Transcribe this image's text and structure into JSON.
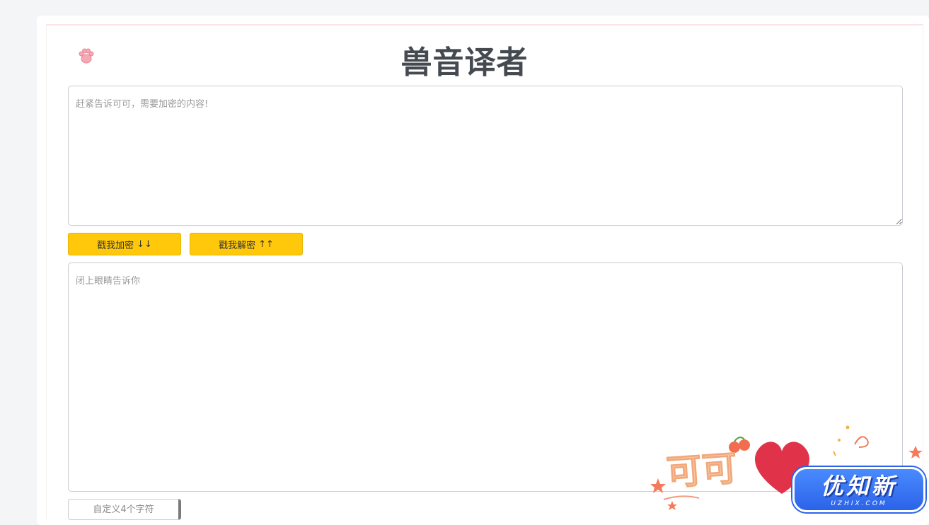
{
  "header": {
    "title": "兽音译者",
    "logo_icon": "paw-icon"
  },
  "input": {
    "placeholder": "赶紧告诉可可，需要加密的内容!",
    "value": ""
  },
  "buttons": {
    "encrypt_label": "戳我加密",
    "encrypt_arrow": "↓↓",
    "decrypt_label": "戳我解密",
    "decrypt_arrow": "↑↑"
  },
  "output": {
    "placeholder": "闭上眼睛告诉你",
    "value": ""
  },
  "custom_key": {
    "placeholder": "自定义4个字符",
    "value": ""
  },
  "decoration": {
    "text": "可可"
  },
  "watermark": {
    "main": "优知新",
    "sub": "UZHIX.COM"
  },
  "colors": {
    "button": "#ffc80a",
    "title": "#444a50",
    "badge": "#2b63e8",
    "heart": "#e0334a"
  }
}
